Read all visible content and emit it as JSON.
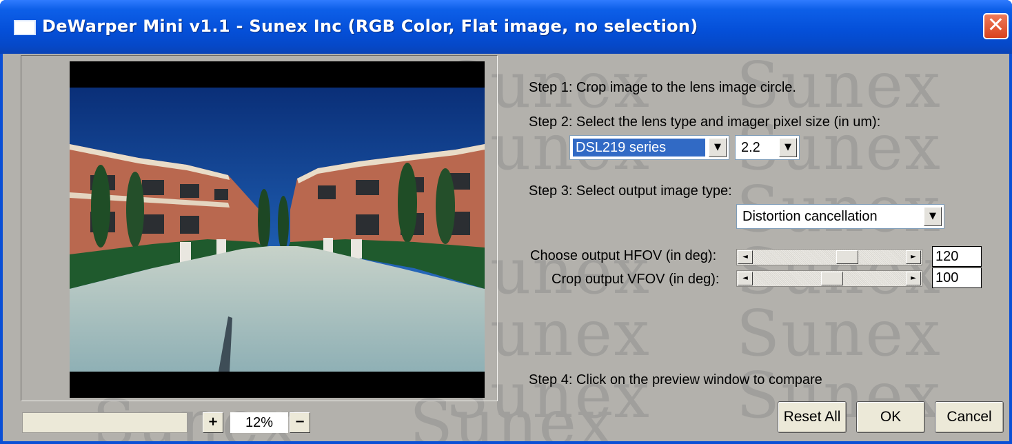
{
  "window": {
    "title": "DeWarper Mini v1.1 - Sunex Inc (RGB Color, Flat image, no selection)",
    "close_glyph": "✕",
    "watermark_text": "Sunex"
  },
  "steps": {
    "step1": "Step 1: Crop image to the lens image circle.",
    "step2": "Step 2: Select the lens type and imager pixel size (in um):",
    "step3": "Step 3: Select output image type:",
    "step4": "Step 4: Click on the preview window to compare"
  },
  "lens_type": {
    "value": "DSL219 series"
  },
  "pixel_size": {
    "value": "2.2"
  },
  "output_type": {
    "value": "Distortion cancellation"
  },
  "hfov": {
    "label": "Choose output HFOV (in deg):",
    "value": "120",
    "slider_fraction": 0.64
  },
  "vfov": {
    "label": "Crop output VFOV (in deg):",
    "value": "100",
    "slider_fraction": 0.52
  },
  "zoom": {
    "plus": "+",
    "minus": "−",
    "value": "12%"
  },
  "buttons": {
    "reset": "Reset All",
    "ok": "OK",
    "cancel": "Cancel"
  },
  "colors": {
    "title_bar": "#0550d9",
    "client_bg": "#b3b1ac",
    "selection": "#316ac5",
    "close": "#d9431e"
  },
  "icons": [
    "window-icon",
    "close-icon",
    "dropdown-arrow-icon",
    "scroll-left-icon",
    "scroll-right-icon"
  ]
}
